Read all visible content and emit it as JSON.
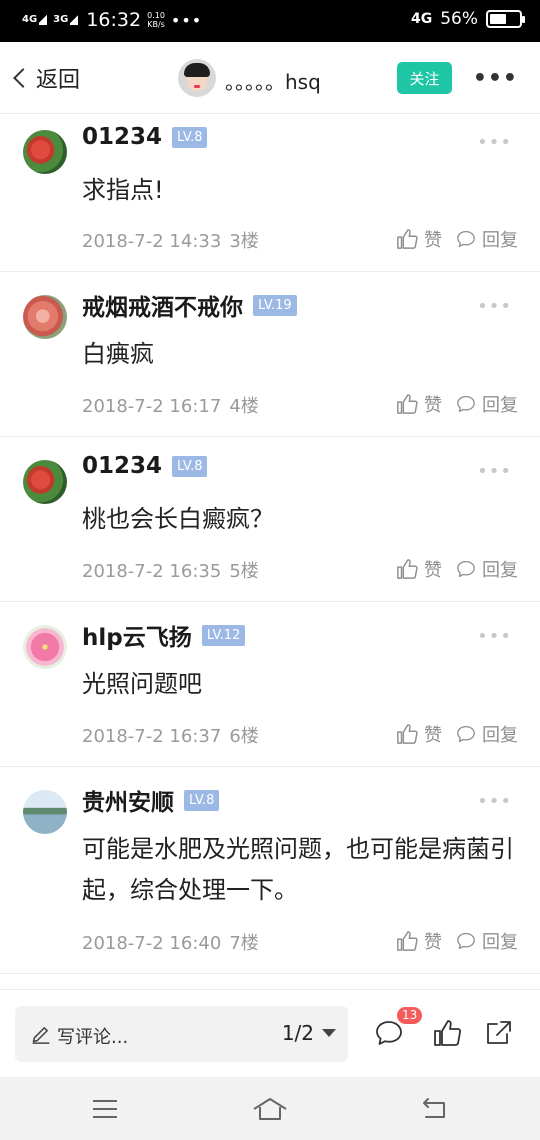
{
  "status_bar": {
    "signal1": "4G",
    "signal2": "3G",
    "time": "16:32",
    "speed_value": "0.10",
    "speed_unit": "KB/s",
    "dots": "•••",
    "network": "4G",
    "battery_percent": "56%",
    "battery_level": 0.56
  },
  "header": {
    "back_label": "返回",
    "author_name": "。。。。。hsq",
    "follow_label": "关注",
    "more_label": "•••"
  },
  "comments": [
    {
      "name": "01234",
      "level": "LV.8",
      "text": "求指点!",
      "date": "2018-7-2 14:33",
      "floor": "3楼",
      "like_label": "赞",
      "reply_label": "回复",
      "more": "•••",
      "avatar": "peach-tree-avatar"
    },
    {
      "name": "戒烟戒酒不戒你",
      "level": "LV.19",
      "text": "白痶疯",
      "date": "2018-7-2 16:17",
      "floor": "4楼",
      "like_label": "赞",
      "reply_label": "回复",
      "more": "•••",
      "avatar": "peach-avatar"
    },
    {
      "name": "01234",
      "level": "LV.8",
      "text": "桃也会长白癜疯？",
      "date": "2018-7-2 16:35",
      "floor": "5楼",
      "like_label": "赞",
      "reply_label": "回复",
      "more": "•••",
      "avatar": "peach-tree-avatar"
    },
    {
      "name": "hlp云飞扬",
      "level": "LV.12",
      "text": "光照问题吧",
      "date": "2018-7-2 16:37",
      "floor": "6楼",
      "like_label": "赞",
      "reply_label": "回复",
      "more": "•••",
      "avatar": "flower-avatar"
    },
    {
      "name": "贵州安顺",
      "level": "LV.8",
      "text": "可能是水肥及光照问题，也可能是病菌引起，综合处理一下。",
      "date": "2018-7-2 16:40",
      "floor": "7楼",
      "like_label": "赞",
      "reply_label": "回复",
      "more": "•••",
      "avatar": "lake-avatar"
    }
  ],
  "bottom_bar": {
    "write_placeholder": "写评论...",
    "page_indicator": "1/2",
    "comment_count": "13"
  },
  "colors": {
    "accent": "#1fc6a6",
    "level_badge": "#9cb9e6",
    "count_badge": "#f45b5b"
  }
}
